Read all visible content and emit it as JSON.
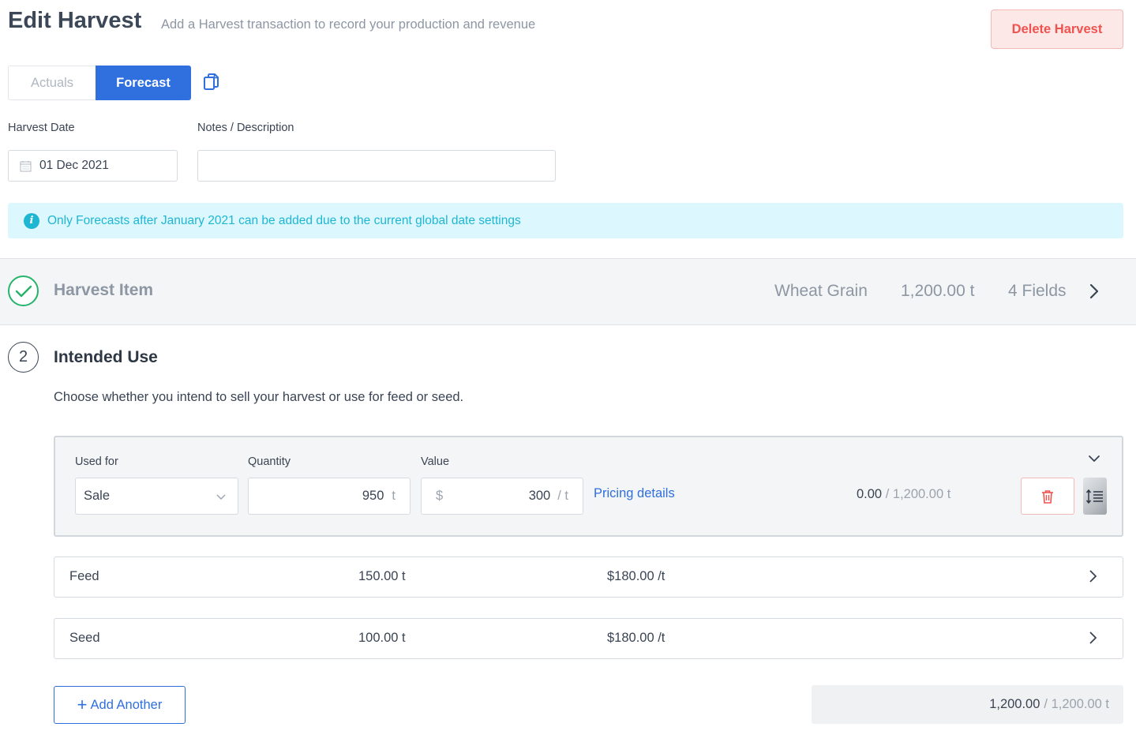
{
  "header": {
    "title": "Edit Harvest",
    "subtitle": "Add a Harvest transaction to record your production and revenue",
    "delete_label": "Delete Harvest"
  },
  "toggle": {
    "actuals_label": "Actuals",
    "forecast_label": "Forecast",
    "selected": "Forecast"
  },
  "form": {
    "harvest_date_label": "Harvest Date",
    "harvest_date_value": "01 Dec 2021",
    "notes_label": "Notes / Description",
    "notes_value": ""
  },
  "info_banner": {
    "text": "Only Forecasts after January 2021 can be added due to the current global date settings"
  },
  "harvest_item": {
    "title": "Harvest Item",
    "crop": "Wheat Grain",
    "quantity": "1,200.00 t",
    "fields": "4 Fields"
  },
  "intended_use": {
    "step_number": "2",
    "title": "Intended Use",
    "description": "Choose whether you intend to sell your harvest or use for feed or seed.",
    "expanded": {
      "used_for_label": "Used for",
      "used_for_value": "Sale",
      "quantity_label": "Quantity",
      "quantity_value": "950",
      "quantity_unit": "t",
      "value_label": "Value",
      "value_currency": "$",
      "value_amount": "300",
      "value_unit": "/ t",
      "pricing_link": "Pricing details",
      "allocated": "0.00",
      "allocated_total": "/ 1,200.00 t"
    },
    "rows": [
      {
        "name": "Feed",
        "quantity": "150.00 t",
        "price": "$180.00 /t"
      },
      {
        "name": "Seed",
        "quantity": "100.00 t",
        "price": "$180.00 /t"
      }
    ],
    "add_label": "Add Another",
    "total": "1,200.00",
    "total_of": "/ 1,200.00 t"
  },
  "colors": {
    "primary": "#2f6fde",
    "danger": "#ef5350",
    "success": "#26b36a",
    "info": "#1fb6d4"
  }
}
